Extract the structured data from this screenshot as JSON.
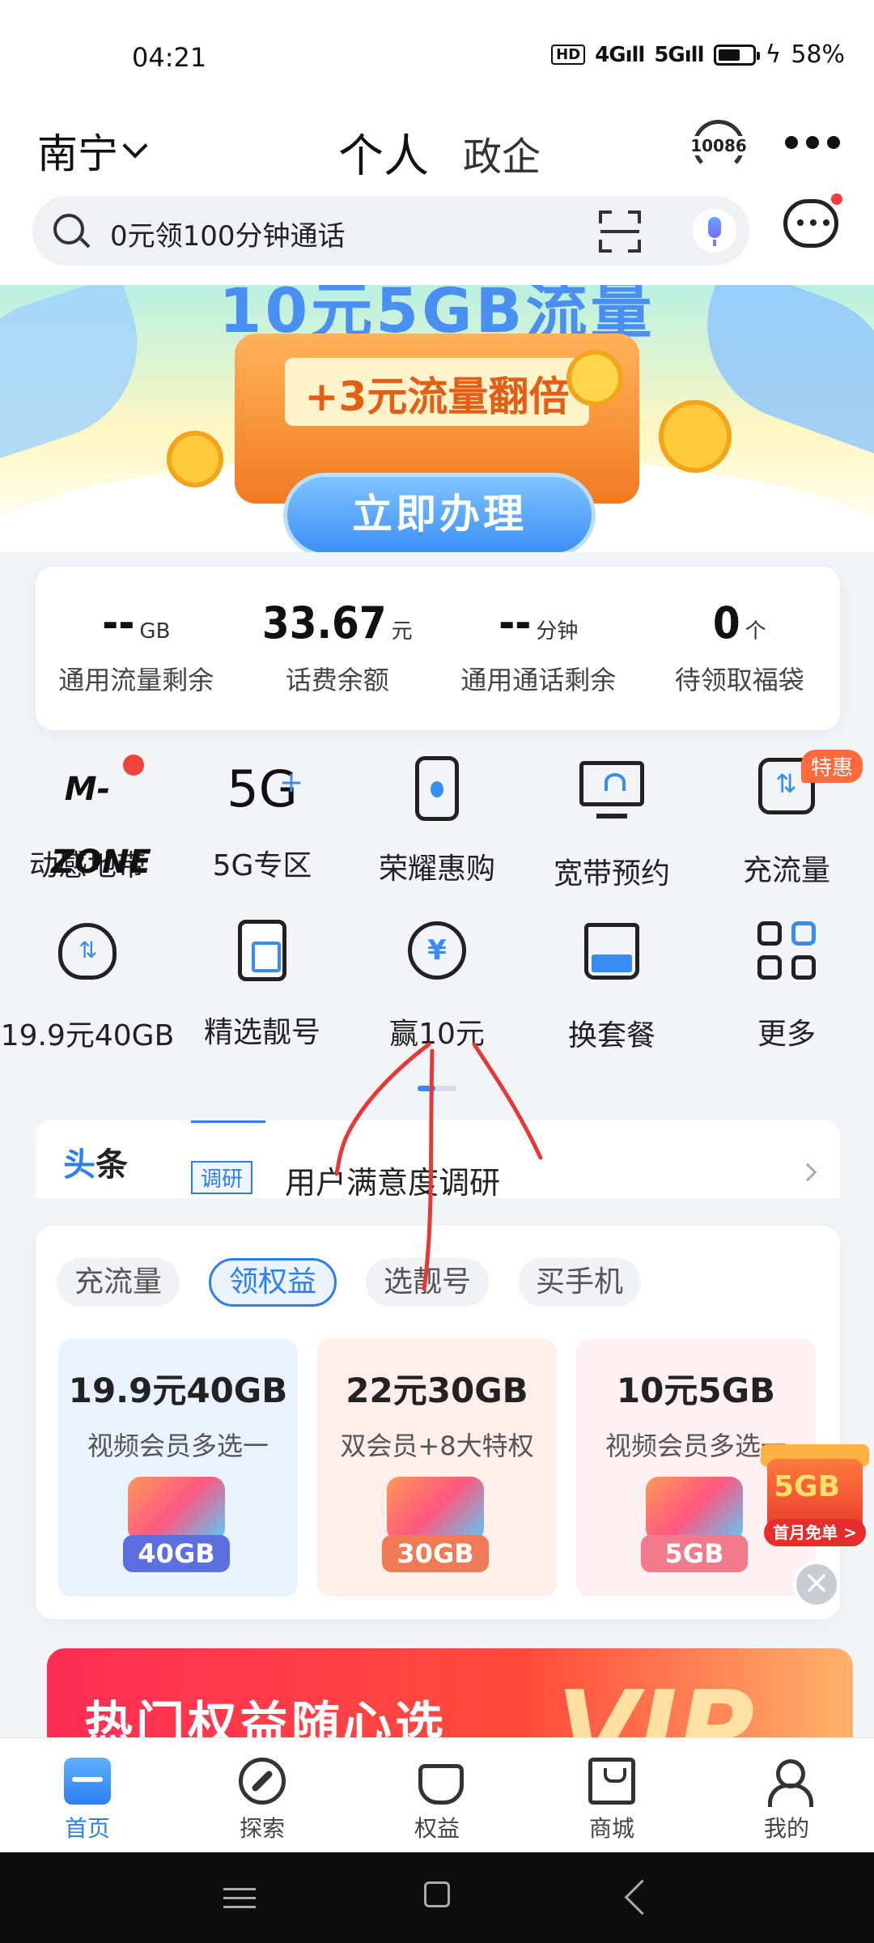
{
  "status_bar": {
    "time": "04:21",
    "network1": "4G",
    "network2": "5G",
    "hd": "HD",
    "battery": "58%"
  },
  "header": {
    "city": "南宁",
    "tab_personal": "个人",
    "tab_gov": "政企",
    "hotline": "10086",
    "search_placeholder": "0元领100分钟通话"
  },
  "banner": {
    "headline": "10元5GB流量",
    "ticket": "+3元流量翻倍",
    "cta": "立即办理"
  },
  "account": [
    {
      "value": "--",
      "unit": "GB",
      "label": "通用流量剩余"
    },
    {
      "value": "33.67",
      "unit": "元",
      "label": "话费余额"
    },
    {
      "value": "--",
      "unit": "分钟",
      "label": "通用通话剩余"
    },
    {
      "value": "0",
      "unit": "个",
      "label": "待领取福袋"
    }
  ],
  "grid": {
    "row1": [
      {
        "label": "动感地带",
        "icon": "mzone-icon",
        "icon_text": "M-ZONE"
      },
      {
        "label": "5G专区",
        "icon": "5g-icon",
        "icon_text": "5G",
        "icon_plus": "+"
      },
      {
        "label": "荣耀惠购",
        "icon": "phone-icon"
      },
      {
        "label": "宽带预约",
        "icon": "tv-wifi-icon"
      },
      {
        "label": "充流量",
        "icon": "data-topup-icon",
        "badge": "特惠"
      }
    ],
    "row2": [
      {
        "label": "19.9元40GB",
        "icon": "bag-icon"
      },
      {
        "label": "精选靓号",
        "icon": "sim-card-icon"
      },
      {
        "label": "赢10元",
        "icon": "yuan-coin-icon",
        "icon_text": "¥"
      },
      {
        "label": "换套餐",
        "icon": "bag-swap-icon"
      },
      {
        "label": "更多",
        "icon": "grid-more-icon"
      }
    ]
  },
  "news": {
    "brand_a": "头",
    "brand_b": "条",
    "tag": "调研",
    "text": "用户满意度调研"
  },
  "offers": {
    "tabs": [
      {
        "label": "充流量",
        "active": false
      },
      {
        "label": "领权益",
        "active": true
      },
      {
        "label": "选靓号",
        "active": false
      },
      {
        "label": "买手机",
        "active": false
      }
    ],
    "cards": [
      {
        "title": "19.9元40GB",
        "subtitle": "视频会员多选一",
        "pack": "40GB"
      },
      {
        "title": "22元30GB",
        "subtitle": "双会员+8大特权",
        "pack": "30GB"
      },
      {
        "title": "10元5GB",
        "subtitle": "视频会员多选一",
        "pack": "5GB"
      }
    ]
  },
  "float_ad": {
    "big": "5GB",
    "sub": "首月免单 >"
  },
  "promo": {
    "title": "热门权益随心选",
    "vip": "VIP"
  },
  "tabbar": [
    {
      "label": "首页",
      "active": true
    },
    {
      "label": "探索",
      "active": false
    },
    {
      "label": "权益",
      "active": false
    },
    {
      "label": "商城",
      "active": false
    },
    {
      "label": "我的",
      "active": false
    }
  ],
  "colors": {
    "accent": "#2d7ff0",
    "annotation": "#e53935",
    "badge": "#ff6a3d"
  }
}
